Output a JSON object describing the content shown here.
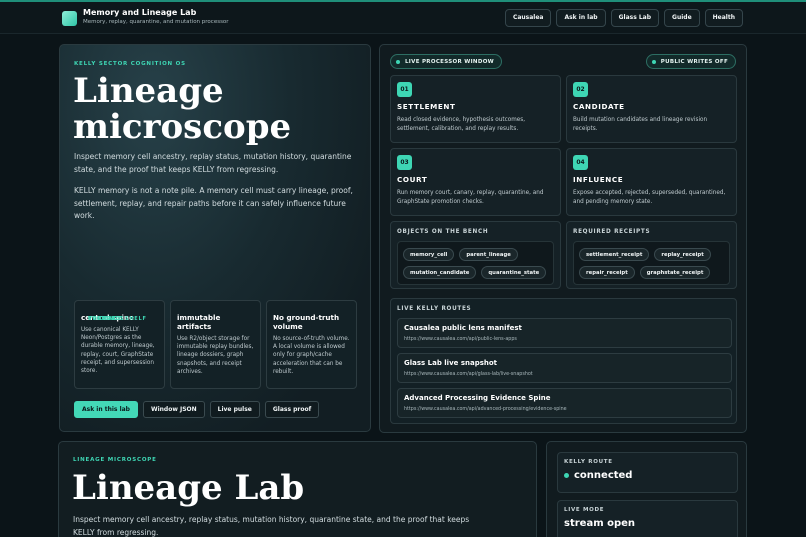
{
  "app": {
    "title": "Memory and Lineage Lab",
    "subtitle": "Memory, replay, quarantine, and mutation processor",
    "nav": [
      "Causalea",
      "Ask in lab",
      "Glass Lab",
      "Guide",
      "Health"
    ]
  },
  "hero": {
    "eyebrow": "KELLY SECTOR COGNITION OS",
    "title": "Lineage microscope",
    "p1": "Inspect memory cell ancestry, replay status, mutation history, quarantine state, and the proof that keeps KELLY from regressing.",
    "p2": "KELLY memory is not a note pile. A memory cell must carry lineage, proof, settlement, replay, and repair paths before it can safely influence future work.",
    "cards": [
      {
        "eyebrow": "POSTGRES",
        "title": "central spine",
        "body": "Use canonical KELLY Neon/Postgres as the durable memory, lineage, replay, court, GraphState receipt, and supersession store."
      },
      {
        "eyebrow": "EVIDENCE SHELF",
        "title": "immutable artifacts",
        "body": "Use R2/object storage for immutable replay bundles, lineage dossiers, graph snapshots, and receipt archives."
      },
      {
        "eyebrow": "VOLUME",
        "title": "No ground-truth volume",
        "body": "No source-of-truth volume. A local volume is allowed only for graph/cache acceleration that can be rebuilt."
      }
    ],
    "actions": [
      "Ask in this lab",
      "Window JSON",
      "Live pulse",
      "Glass proof"
    ]
  },
  "panel": {
    "live_label": "LIVE PROCESSOR WINDOW",
    "writes_label": "PUBLIC WRITES OFF",
    "steps": [
      {
        "num": "01",
        "title": "SETTLEMENT",
        "body": "Read closed evidence, hypothesis outcomes, settlement, calibration, and replay results."
      },
      {
        "num": "02",
        "title": "CANDIDATE",
        "body": "Build mutation candidates and lineage revision receipts."
      },
      {
        "num": "03",
        "title": "COURT",
        "body": "Run memory court, canary, replay, quarantine, and GraphState promotion checks."
      },
      {
        "num": "04",
        "title": "INFLUENCE",
        "body": "Expose accepted, rejected, superseded, quarantined, and pending memory state."
      }
    ],
    "bench": {
      "objects_label": "OBJECTS ON THE BENCH",
      "objects": [
        "memory_cell",
        "parent_lineage",
        "mutation_candidate",
        "quarantine_state"
      ],
      "receipts_label": "REQUIRED RECEIPTS",
      "receipts": [
        "settlement_receipt",
        "replay_receipt",
        "repair_receipt",
        "graphstate_receipt"
      ]
    },
    "routes_label": "LIVE KELLY ROUTES",
    "routes": [
      {
        "title": "Causalea public lens manifest",
        "url": "https://www.causalea.com/api/public-lens-apps"
      },
      {
        "title": "Glass Lab live snapshot",
        "url": "https://www.causalea.com/api/glass-lab/live-snapshot"
      },
      {
        "title": "Advanced Processing Evidence Spine",
        "url": "https://www.causalea.com/api/advanced-processing/evidence-spine"
      }
    ]
  },
  "lab": {
    "eyebrow": "LINEAGE MICROSCOPE",
    "title": "Lineage Lab",
    "body": "Inspect memory cell ancestry, replay status, mutation history, quarantine state, and the proof that keeps KELLY from regressing."
  },
  "side": {
    "route_label": "KELLY ROUTE",
    "route_value": "connected",
    "mode_label": "LIVE MODE",
    "mode_value": "stream open"
  },
  "colors": {
    "accent": "#3ed6b4",
    "background": "#0b1418",
    "panel": "#111b1f"
  }
}
